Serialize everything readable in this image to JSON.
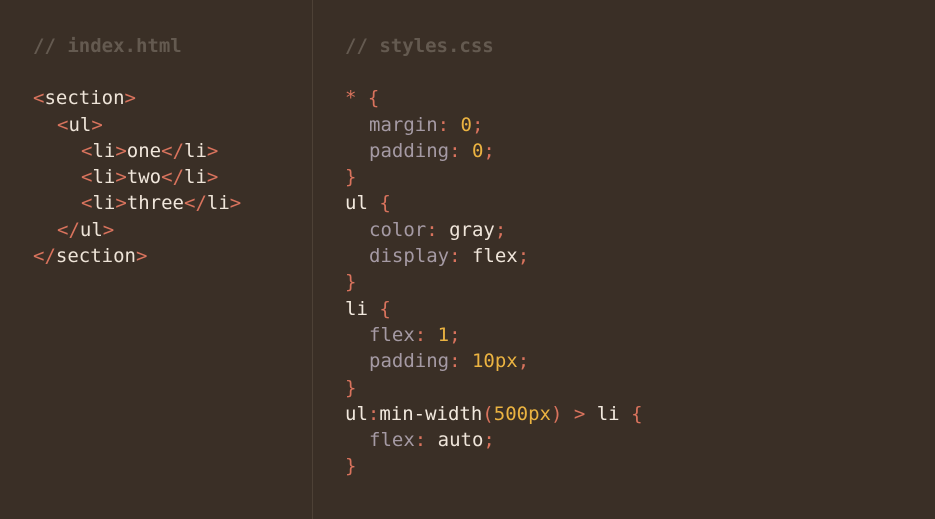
{
  "html_pane": {
    "file_comment": "// index.html",
    "lines": [
      {
        "open": "<",
        "tag": "section",
        "close": ">"
      },
      {
        "open": "<",
        "tag": "ul",
        "close": ">"
      },
      {
        "open": "<",
        "tag": "li",
        "close": ">",
        "text": "one",
        "end_open": "</",
        "end_tag": "li",
        "end_close": ">"
      },
      {
        "open": "<",
        "tag": "li",
        "close": ">",
        "text": "two",
        "end_open": "</",
        "end_tag": "li",
        "end_close": ">"
      },
      {
        "open": "<",
        "tag": "li",
        "close": ">",
        "text": "three",
        "end_open": "</",
        "end_tag": "li",
        "end_close": ">"
      },
      {
        "open": "</",
        "tag": "ul",
        "close": ">"
      },
      {
        "open": "</",
        "tag": "section",
        "close": ">"
      }
    ]
  },
  "css_pane": {
    "file_comment": "// styles.css",
    "rule1": {
      "selector": "*",
      "open": " {",
      "decls": [
        {
          "prop": "margin",
          "value": "0"
        },
        {
          "prop": "padding",
          "value": "0"
        }
      ],
      "close": "}"
    },
    "rule2": {
      "selector": "ul",
      "open": " {",
      "decls": [
        {
          "prop": "color",
          "value": "gray"
        },
        {
          "prop": "display",
          "value": "flex"
        }
      ],
      "close": "}"
    },
    "rule3": {
      "selector": "li",
      "open": " {",
      "decls": [
        {
          "prop": "flex",
          "value": "1"
        },
        {
          "prop": "padding",
          "value": "10px"
        }
      ],
      "close": "}"
    },
    "rule4": {
      "sel_a": "ul",
      "sel_b": ":min-width",
      "paren_open": "(",
      "arg": "500px",
      "paren_close": ")",
      "combinator": " > ",
      "sel_c": "li",
      "open": " {",
      "decls": [
        {
          "prop": "flex",
          "value": "auto"
        }
      ],
      "close": "}"
    },
    "colon": ": ",
    "semicolon": ";"
  },
  "colors": {
    "background": "#3a2f26",
    "comment": "#645a50",
    "bracket": "#d9735d",
    "property": "#a59aa4",
    "number": "#ebb341",
    "text": "#f1e7dc"
  }
}
